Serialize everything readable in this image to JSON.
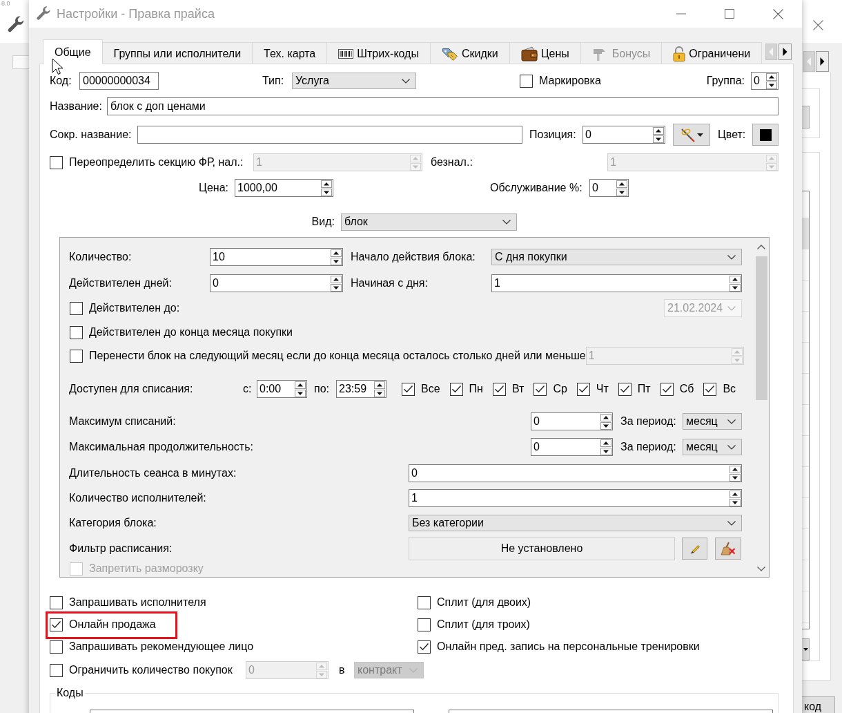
{
  "desktop": {
    "corner_text": "8.0"
  },
  "background_window": {
    "button_label": "код"
  },
  "window": {
    "title": "Настройки - Правка прайса"
  },
  "tabs": [
    {
      "label": "Общие",
      "selected": true,
      "disabled": false
    },
    {
      "label": "Группы или исполнители",
      "selected": false,
      "disabled": false
    },
    {
      "label": "Тех. карта",
      "selected": false,
      "disabled": false
    },
    {
      "label": "Штрих-коды",
      "selected": false,
      "disabled": false
    },
    {
      "label": "Скидки",
      "selected": false,
      "disabled": false
    },
    {
      "label": "Цены",
      "selected": false,
      "disabled": false
    },
    {
      "label": "Бонусы",
      "selected": false,
      "disabled": true
    },
    {
      "label": "Ограничени",
      "selected": false,
      "disabled": false
    }
  ],
  "general": {
    "code": {
      "label": "Код:",
      "value": "00000000034"
    },
    "type": {
      "label": "Тип:",
      "value": "Услуга"
    },
    "marking": {
      "label": "Маркировка",
      "checked": false
    },
    "group": {
      "label": "Группа:",
      "value": "0"
    },
    "name": {
      "label": "Название:",
      "value": "блок с доп ценами"
    },
    "short_name": {
      "label": "Сокр. название:"
    },
    "position": {
      "label": "Позиция:",
      "value": "0"
    },
    "color": {
      "label": "Цвет:"
    },
    "fr_section": {
      "label": "Переопределить секцию ФР, нал.:",
      "checked": false,
      "value": "1",
      "disabled": true
    },
    "cashless": {
      "label": "безнал.:",
      "value": "1",
      "disabled": true
    },
    "price": {
      "label": "Цена:",
      "value": "1000,00"
    },
    "service": {
      "label": "Обслуживание %:",
      "value": "0"
    },
    "view": {
      "label": "Вид:",
      "value": "блок"
    }
  },
  "block": {
    "quantity": {
      "label": "Количество:",
      "value": "10"
    },
    "start": {
      "label": "Начало действия блока:",
      "value": "С дня покупки"
    },
    "valid_days": {
      "label": "Действителен дней:",
      "value": "0"
    },
    "start_day": {
      "label": "Начиная с дня:",
      "value": "1"
    },
    "valid_until": {
      "label": "Действителен до:",
      "checked": false,
      "value": "21.02.2024",
      "disabled": true
    },
    "month_end": {
      "label": "Действителен до конца месяца покупки",
      "checked": false
    },
    "carry_over": {
      "label": "Перенести блок на следующий месяц если до конца месяца осталось столько дней или меньше",
      "checked": false,
      "value": "1",
      "disabled": true
    },
    "availability": {
      "label": "Доступен для списания:",
      "from_label": "с:",
      "from": "0:00",
      "to_label": "по:",
      "to": "23:59"
    },
    "days": [
      {
        "label": "Все",
        "checked": true
      },
      {
        "label": "Пн",
        "checked": true
      },
      {
        "label": "Вт",
        "checked": true
      },
      {
        "label": "Ср",
        "checked": true
      },
      {
        "label": "Чт",
        "checked": true
      },
      {
        "label": "Пт",
        "checked": true
      },
      {
        "label": "Сб",
        "checked": true
      },
      {
        "label": "Вс",
        "checked": true
      }
    ],
    "max_uses": {
      "label": "Максимум списаний:",
      "value": "0",
      "period_label": "За период:",
      "period": "месяц"
    },
    "max_duration": {
      "label": "Максимальная продолжительность:",
      "value": "0",
      "period_label": "За период:",
      "period": "месяц"
    },
    "session_length": {
      "label": "Длительность сеанса в минутах:",
      "value": "0"
    },
    "performers": {
      "label": "Количество исполнителей:",
      "value": "1"
    },
    "category": {
      "label": "Категория блока:",
      "value": "Без категории"
    },
    "schedule_filter": {
      "label": "Фильтр расписания:",
      "value": "Не установлено"
    },
    "no_unfreeze": {
      "label": "Запретить разморозку",
      "checked": false,
      "disabled": true
    }
  },
  "options": [
    {
      "label": "Запрашивать исполнителя",
      "checked": false,
      "highlighted": false
    },
    {
      "label": "Сплит (для двоих)",
      "checked": false,
      "highlighted": false
    },
    {
      "label": "Онлайн продажа",
      "checked": true,
      "highlighted": true
    },
    {
      "label": "Сплит (для троих)",
      "checked": false,
      "highlighted": false
    },
    {
      "label": "Запрашивать рекомендующее лицо",
      "checked": false,
      "highlighted": false
    },
    {
      "label": "Онлайн пред. запись на персональные тренировки",
      "checked": true,
      "highlighted": false
    }
  ],
  "purchase_limit": {
    "label": "Ограничить количество покупок",
    "checked": false,
    "value": "0",
    "disabled": true,
    "in_label": "в",
    "period": "контракт"
  },
  "codes": {
    "title": "Коды"
  }
}
